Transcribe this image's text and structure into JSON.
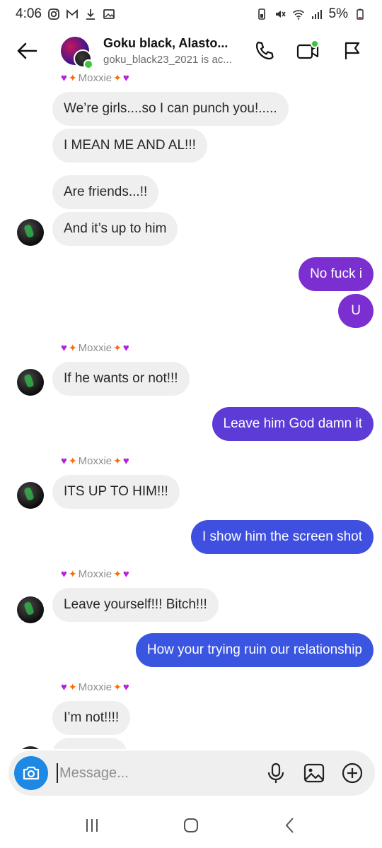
{
  "status_bar": {
    "time": "4:06",
    "battery": "5%"
  },
  "header": {
    "title": "Goku black, Alasto...",
    "subtitle": "goku_black23_2021 is ac..."
  },
  "messages": [
    {
      "type": "sender",
      "name": "Moxxie"
    },
    {
      "type": "in",
      "text": "We’re girls....so I can punch you!....."
    },
    {
      "type": "in",
      "text": "I MEAN ME AND AL!!!"
    },
    {
      "type": "in",
      "text": "Are friends...!!"
    },
    {
      "type": "in",
      "text": "And it’s up to him"
    },
    {
      "type": "out",
      "text": "No fuck i"
    },
    {
      "type": "out",
      "text": "U"
    },
    {
      "type": "sender",
      "name": "Moxxie"
    },
    {
      "type": "in",
      "text": "If he wants or not!!!"
    },
    {
      "type": "out",
      "text": "Leave him God damn it"
    },
    {
      "type": "sender",
      "name": "Moxxie"
    },
    {
      "type": "in",
      "text": "ITS UP TO HIM!!!"
    },
    {
      "type": "out",
      "text": "I show him the screen shot"
    },
    {
      "type": "sender",
      "name": "Moxxie"
    },
    {
      "type": "in",
      "text": "Leave yourself!!! Bitch!!!"
    },
    {
      "type": "out",
      "text": "How your trying ruin our relationship"
    },
    {
      "type": "sender",
      "name": "Moxxie"
    },
    {
      "type": "in",
      "text": "I’m not!!!!"
    }
  ],
  "composer": {
    "placeholder": "Message..."
  },
  "colors": {
    "out_purple": "#7b2fd0",
    "out_violet": "#5d3bd6",
    "out_blue": "#3a55e0",
    "in_gray": "#efefef",
    "camera_blue": "#1e88e5"
  },
  "icons": {
    "back": "arrow-left-icon",
    "call": "phone-icon",
    "video": "video-camera-icon",
    "flag": "flag-icon",
    "camera": "camera-icon",
    "mic": "microphone-icon",
    "gallery": "image-icon",
    "add": "plus-circle-icon"
  }
}
